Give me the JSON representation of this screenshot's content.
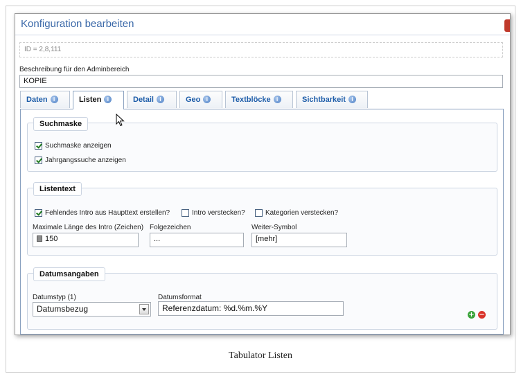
{
  "window": {
    "title": "Konfiguration bearbeiten"
  },
  "id_text": "ID = 2,8,111",
  "description": {
    "label": "Beschreibung für den Adminbereich",
    "value": "KOPIE"
  },
  "tabs": [
    {
      "label": "Daten"
    },
    {
      "label": "Listen"
    },
    {
      "label": "Detail"
    },
    {
      "label": "Geo"
    },
    {
      "label": "Textblöcke"
    },
    {
      "label": "Sichtbarkeit"
    }
  ],
  "active_tab": "Listen",
  "suchmaske": {
    "legend": "Suchmaske",
    "show_search": {
      "label": "Suchmaske anzeigen",
      "checked": true
    },
    "year_search": {
      "label": "Jahrgangssuche anzeigen",
      "checked": true
    }
  },
  "listentext": {
    "legend": "Listentext",
    "missing_intro": {
      "label": "Fehlendes Intro aus Haupttext erstellen?",
      "checked": true
    },
    "hide_intro": {
      "label": "Intro verstecken?",
      "checked": false
    },
    "hide_categories": {
      "label": "Kategorien verstecken?",
      "checked": false
    },
    "max_length": {
      "label": "Maximale Länge des Intro (Zeichen)",
      "value": "150"
    },
    "follow_chars": {
      "label": "Folgezeichen",
      "value": "..."
    },
    "more_symbol": {
      "label": "Weiter-Symbol",
      "value": "[mehr]"
    }
  },
  "datumsangaben": {
    "legend": "Datumsangaben",
    "date_type": {
      "label": "Datumstyp (1)",
      "value": "Datumsbezug"
    },
    "date_format": {
      "label": "Datumsformat",
      "value": "Referenzdatum: %d.%m.%Y"
    },
    "add_symbol": "+",
    "remove_symbol": "−"
  },
  "caption": "Tabulator Listen",
  "colors": {
    "accent": "#1b5ba8",
    "title": "#3a68a8",
    "add": "#3aa33a",
    "remove": "#d9342b",
    "close": "#c0392b"
  }
}
